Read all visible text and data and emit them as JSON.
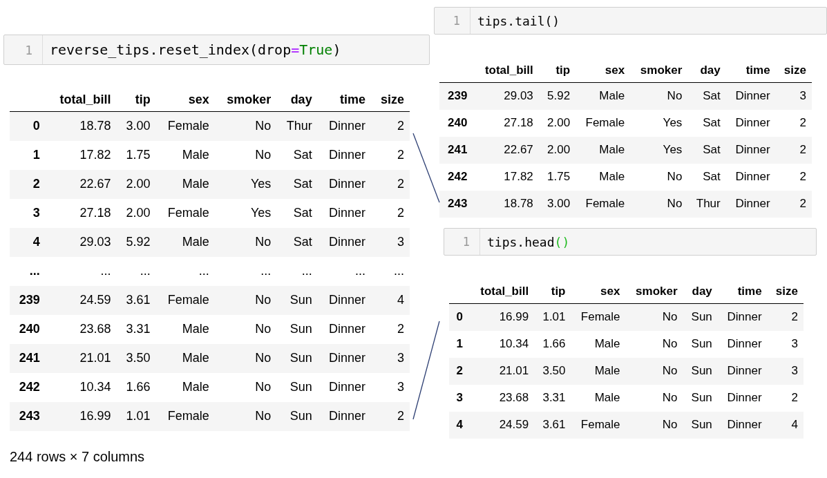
{
  "cells": [
    {
      "line_number": "1",
      "code": [
        {
          "kind": "plain",
          "text": "reverse_tips.reset_index(drop"
        },
        {
          "kind": "operator",
          "text": "="
        },
        {
          "kind": "keyword",
          "text": "True"
        },
        {
          "kind": "plain",
          "text": ")"
        }
      ],
      "table": {
        "columns": [
          "total_bill",
          "tip",
          "sex",
          "smoker",
          "day",
          "time",
          "size"
        ],
        "rows": [
          {
            "index": "0",
            "cells": [
              "18.78",
              "3.00",
              "Female",
              "No",
              "Thur",
              "Dinner",
              "2"
            ]
          },
          {
            "index": "1",
            "cells": [
              "17.82",
              "1.75",
              "Male",
              "No",
              "Sat",
              "Dinner",
              "2"
            ]
          },
          {
            "index": "2",
            "cells": [
              "22.67",
              "2.00",
              "Male",
              "Yes",
              "Sat",
              "Dinner",
              "2"
            ]
          },
          {
            "index": "3",
            "cells": [
              "27.18",
              "2.00",
              "Female",
              "Yes",
              "Sat",
              "Dinner",
              "2"
            ]
          },
          {
            "index": "4",
            "cells": [
              "29.03",
              "5.92",
              "Male",
              "No",
              "Sat",
              "Dinner",
              "3"
            ]
          },
          {
            "index": "...",
            "cells": [
              "...",
              "...",
              "...",
              "...",
              "...",
              "...",
              "..."
            ]
          },
          {
            "index": "239",
            "cells": [
              "24.59",
              "3.61",
              "Female",
              "No",
              "Sun",
              "Dinner",
              "4"
            ]
          },
          {
            "index": "240",
            "cells": [
              "23.68",
              "3.31",
              "Male",
              "No",
              "Sun",
              "Dinner",
              "2"
            ]
          },
          {
            "index": "241",
            "cells": [
              "21.01",
              "3.50",
              "Male",
              "No",
              "Sun",
              "Dinner",
              "3"
            ]
          },
          {
            "index": "242",
            "cells": [
              "10.34",
              "1.66",
              "Male",
              "No",
              "Sun",
              "Dinner",
              "3"
            ]
          },
          {
            "index": "243",
            "cells": [
              "16.99",
              "1.01",
              "Female",
              "No",
              "Sun",
              "Dinner",
              "2"
            ]
          }
        ]
      },
      "footer": "244 rows × 7 columns"
    },
    {
      "line_number": "1",
      "code": [
        {
          "kind": "plain",
          "text": "tips.tail()"
        }
      ],
      "table": {
        "columns": [
          "total_bill",
          "tip",
          "sex",
          "smoker",
          "day",
          "time",
          "size"
        ],
        "rows": [
          {
            "index": "239",
            "cells": [
              "29.03",
              "5.92",
              "Male",
              "No",
              "Sat",
              "Dinner",
              "3"
            ]
          },
          {
            "index": "240",
            "cells": [
              "27.18",
              "2.00",
              "Female",
              "Yes",
              "Sat",
              "Dinner",
              "2"
            ]
          },
          {
            "index": "241",
            "cells": [
              "22.67",
              "2.00",
              "Male",
              "Yes",
              "Sat",
              "Dinner",
              "2"
            ]
          },
          {
            "index": "242",
            "cells": [
              "17.82",
              "1.75",
              "Male",
              "No",
              "Sat",
              "Dinner",
              "2"
            ]
          },
          {
            "index": "243",
            "cells": [
              "18.78",
              "3.00",
              "Female",
              "No",
              "Thur",
              "Dinner",
              "2"
            ]
          }
        ]
      }
    },
    {
      "line_number": "1",
      "code": [
        {
          "kind": "plain",
          "text": "tips.head"
        },
        {
          "kind": "bracket-match",
          "text": "()"
        }
      ],
      "table": {
        "columns": [
          "total_bill",
          "tip",
          "sex",
          "smoker",
          "day",
          "time",
          "size"
        ],
        "rows": [
          {
            "index": "0",
            "cells": [
              "16.99",
              "1.01",
              "Female",
              "No",
              "Sun",
              "Dinner",
              "2"
            ]
          },
          {
            "index": "1",
            "cells": [
              "10.34",
              "1.66",
              "Male",
              "No",
              "Sun",
              "Dinner",
              "3"
            ]
          },
          {
            "index": "2",
            "cells": [
              "21.01",
              "3.50",
              "Male",
              "No",
              "Sun",
              "Dinner",
              "3"
            ]
          },
          {
            "index": "3",
            "cells": [
              "23.68",
              "3.31",
              "Male",
              "No",
              "Sun",
              "Dinner",
              "2"
            ]
          },
          {
            "index": "4",
            "cells": [
              "24.59",
              "3.61",
              "Female",
              "No",
              "Sun",
              "Dinner",
              "4"
            ]
          }
        ]
      }
    }
  ]
}
